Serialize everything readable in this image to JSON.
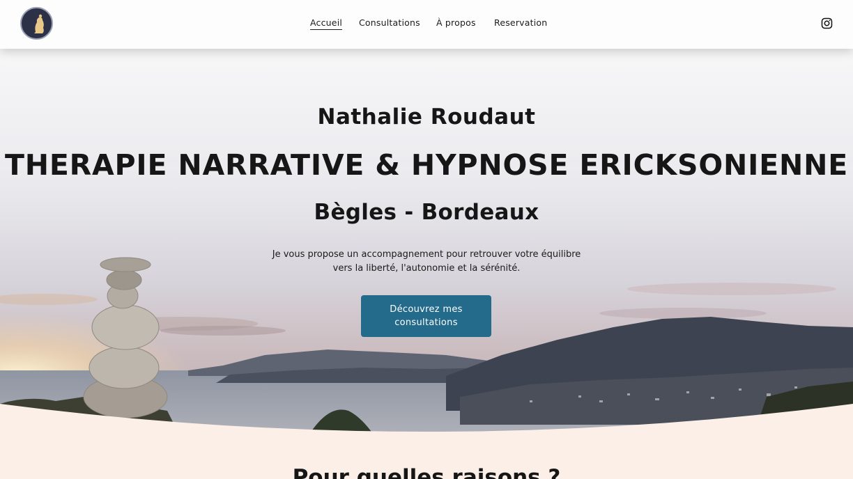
{
  "header": {
    "logo_alt": "Nathalie Roudaut logo",
    "nav": [
      {
        "label": "Accueil",
        "active": true
      },
      {
        "label": "Consultations",
        "active": false
      },
      {
        "label": "À propos",
        "active": false
      },
      {
        "label": "Reservation",
        "active": false
      }
    ],
    "social_icon": "instagram-icon"
  },
  "hero": {
    "name": "Nathalie Roudaut",
    "title": "THERAPIE NARRATIVE & HYPNOSE ERICKSONIENNE",
    "location": "Bègles - Bordeaux",
    "description_line1": "Je vous propose un accompagnement pour retrouver votre équilibre",
    "description_line2": "vers la liberté, l'autonomie et la sérénité.",
    "cta_label": "Découvrez mes consultations"
  },
  "next_section": {
    "title": "Pour quelles raisons ?"
  },
  "colors": {
    "cta": "#236a8b",
    "section_bg": "#fcefe7",
    "logo_bg": "#2d3147"
  }
}
